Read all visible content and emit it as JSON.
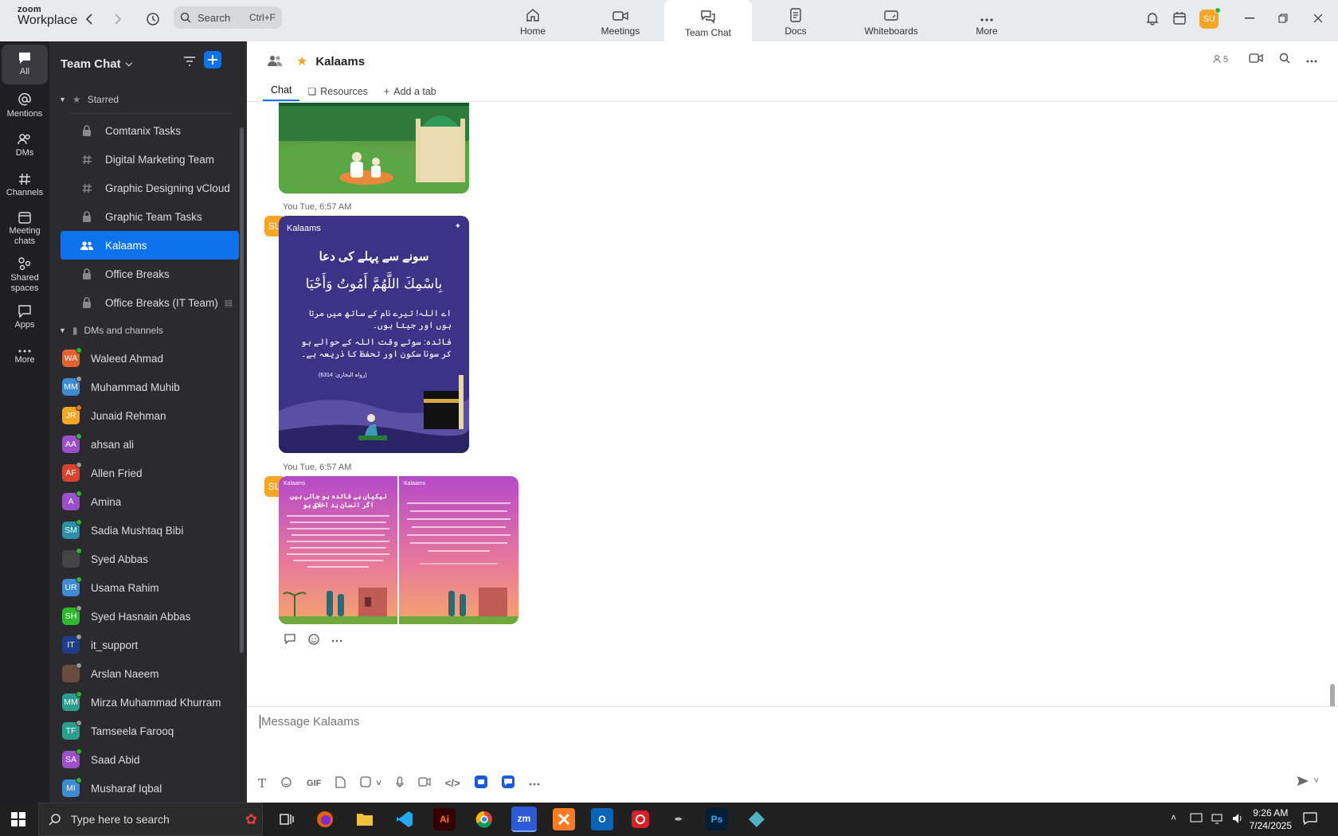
{
  "app": {
    "logo_top": "zoom",
    "logo_bottom": "Workplace"
  },
  "search": {
    "placeholder": "Search",
    "shortcut": "Ctrl+F"
  },
  "tabs": [
    {
      "label": "Home"
    },
    {
      "label": "Meetings"
    },
    {
      "label": "Team Chat"
    },
    {
      "label": "Docs"
    },
    {
      "label": "Whiteboards"
    },
    {
      "label": "More"
    }
  ],
  "user": {
    "initials": "SU"
  },
  "rail": [
    {
      "label": "All"
    },
    {
      "label": "Mentions"
    },
    {
      "label": "DMs"
    },
    {
      "label": "Channels"
    },
    {
      "label": "Meeting chats"
    },
    {
      "label": "Shared spaces"
    },
    {
      "label": "Apps"
    },
    {
      "label": "More"
    }
  ],
  "sidebar": {
    "title": "Team Chat",
    "starred_label": "Starred",
    "starred": [
      {
        "label": "Comtanix Tasks",
        "icon": "lock-icon"
      },
      {
        "label": "Digital Marketing Team",
        "icon": "hash-icon"
      },
      {
        "label": "Graphic Designing vCloud",
        "icon": "hash-icon"
      },
      {
        "label": "Graphic Team Tasks",
        "icon": "lock-icon"
      },
      {
        "label": "Kalaams",
        "icon": "group-icon"
      },
      {
        "label": "Office Breaks",
        "icon": "lock-icon"
      },
      {
        "label": "Office Breaks (IT Team)",
        "icon": "lock-icon"
      }
    ],
    "dms_label": "DMs and channels",
    "dms": [
      {
        "initials": "WA",
        "name": "Waleed Ahmad",
        "color": "#e0622c",
        "status": "#2eb82e"
      },
      {
        "initials": "MM",
        "name": "Muhammad Muhib",
        "color": "#3d8bd4",
        "status": "#999"
      },
      {
        "initials": "JR",
        "name": "Junaid Rehman",
        "color": "#f5a623",
        "status": "#e8702a"
      },
      {
        "initials": "AA",
        "name": "ahsan ali",
        "color": "#9b4fc9",
        "status": "#2eb82e"
      },
      {
        "initials": "AF",
        "name": "Allen Fried",
        "color": "#d9432f",
        "status": "#999"
      },
      {
        "initials": "A",
        "name": "Amina",
        "color": "#9b4fc9",
        "status": "#2eb82e"
      },
      {
        "initials": "SM",
        "name": "Sadia Mushtaq Bibi",
        "color": "#2c8fa8",
        "status": "#2eb82e"
      },
      {
        "initials": "",
        "name": "Syed Abbas",
        "color": "#444",
        "status": "#2eb82e"
      },
      {
        "initials": "UR",
        "name": "Usama Rahim",
        "color": "#3d8bd4",
        "status": "#2eb82e"
      },
      {
        "initials": "SH",
        "name": "Syed Hasnain Abbas",
        "color": "#2eb82e",
        "status": "#999"
      },
      {
        "initials": "IT",
        "name": "it_support",
        "color": "#1d3f8a",
        "status": "#999"
      },
      {
        "initials": "",
        "name": "Arslan Naeem",
        "color": "#6b4b3e",
        "status": "#999"
      },
      {
        "initials": "MM",
        "name": "Mirza Muhammad Khurram",
        "color": "#2a9d8f",
        "status": "#2eb82e"
      },
      {
        "initials": "TF",
        "name": "Tamseela Farooq",
        "color": "#2a9d8f",
        "status": "#999"
      },
      {
        "initials": "SA",
        "name": "Saad Abid",
        "color": "#9b4fc9",
        "status": "#2eb82e"
      },
      {
        "initials": "MI",
        "name": "Musharaf Iqbal",
        "color": "#3d8bd4",
        "status": "#2eb82e"
      }
    ]
  },
  "chat": {
    "title": "Kalaams",
    "members": "5",
    "subtabs": {
      "chat": "Chat",
      "resources": "Resources",
      "add": "Add a tab"
    },
    "messages": [
      {
        "meta": "You Tue, 6:57 AM"
      },
      {
        "meta": "You Tue, 6:57 AM"
      }
    ],
    "poster2": {
      "brand": "Kalaams",
      "heading": "سونے سے پہلے کی دعا",
      "arabic": "بِاسْمِكَ اللَّهُمَّ أَمُوتُ وَأَحْيَا",
      "translation": "اے اللہ! تیرے نام کے ساتھ میں مرتا ہوں اور جیتا ہوں۔",
      "benefit": "فائدہ: سوتے وقت اللہ کے حوالے ہو کر سونا سکون اور تحفظ کا ذریعہ ہے۔",
      "ref": "(رواہ البخاري: 6314)"
    },
    "poster3a": {
      "brand": "Kalaams",
      "heading": "نیکیاں بے فائدہ ہو جاتی ہیں اگر انسان بد اخلاق ہو"
    },
    "poster3b": {
      "brand": "Kalaams"
    },
    "composer_placeholder": "Message Kalaams",
    "tools": {
      "gif": "GIF"
    }
  },
  "taskbar": {
    "search_placeholder": "Type here to search",
    "time": "9:26 AM",
    "date": "7/24/2025"
  }
}
